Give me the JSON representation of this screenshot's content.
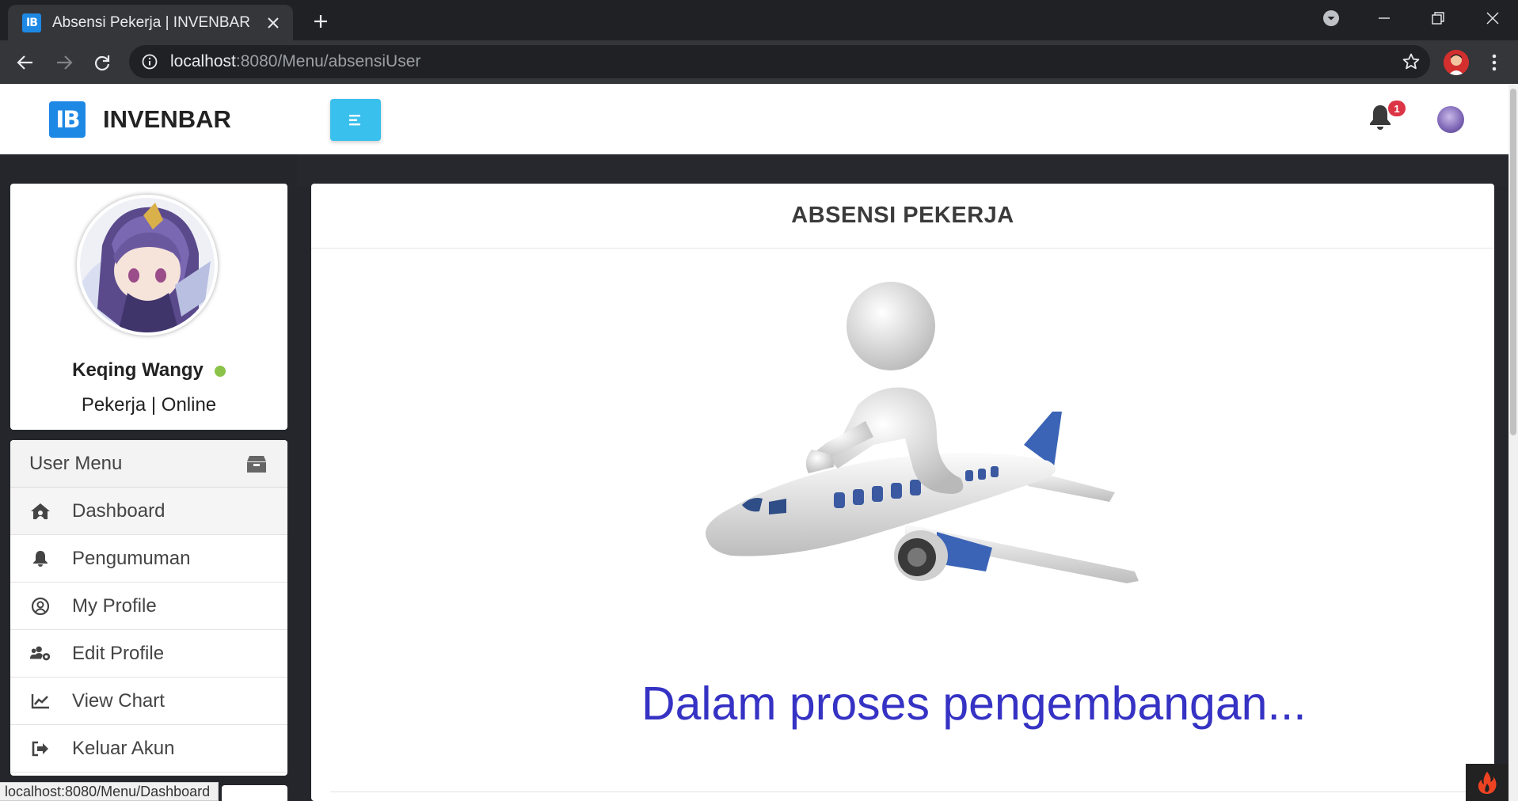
{
  "browser": {
    "tab_title": "Absensi Pekerja | INVENBAR",
    "favicon_text": "IB",
    "url_host": "localhost",
    "url_path": ":8080/Menu/absensiUser",
    "status_url": "localhost:8080/Menu/Dashboard"
  },
  "topbar": {
    "logo_text": "IB",
    "brand": "INVENBAR",
    "notification_count": "1"
  },
  "profile": {
    "name": "Keqing Wangy",
    "role": "Pekerja | Online"
  },
  "menu": {
    "header": "User Menu",
    "items": [
      {
        "label": "Dashboard",
        "icon": "home-icon"
      },
      {
        "label": "Pengumuman",
        "icon": "bell-icon"
      },
      {
        "label": "My Profile",
        "icon": "user-circle-icon"
      },
      {
        "label": "Edit Profile",
        "icon": "users-cog-icon"
      },
      {
        "label": "View Chart",
        "icon": "chart-line-icon"
      },
      {
        "label": "Keluar Akun",
        "icon": "sign-out-icon"
      }
    ]
  },
  "content": {
    "title": "ABSENSI PEKERJA",
    "message": "Dalam proses pengembangan..."
  },
  "colors": {
    "accent": "#39c0ed",
    "brand_blue": "#1e88e5",
    "message": "#3532c4",
    "badge": "#dc3545",
    "online": "#8bc34a"
  }
}
